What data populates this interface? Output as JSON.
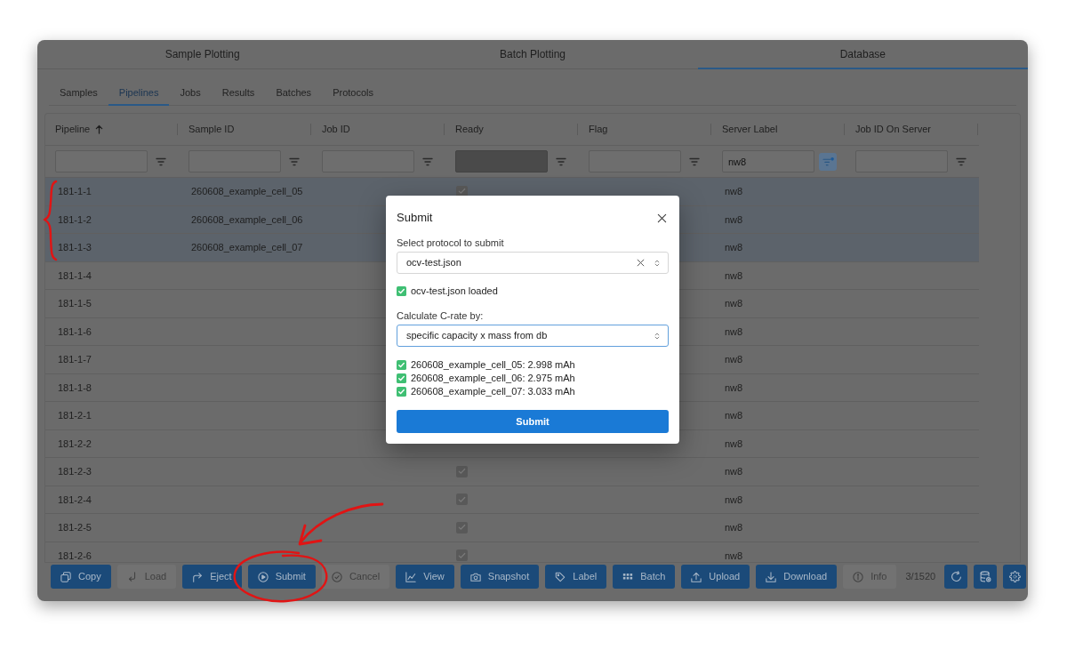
{
  "main_tabs": [
    {
      "label": "Sample Plotting",
      "selected": false
    },
    {
      "label": "Batch Plotting",
      "selected": false
    },
    {
      "label": "Database",
      "selected": true
    }
  ],
  "sub_tabs": [
    {
      "label": "Samples",
      "selected": false
    },
    {
      "label": "Pipelines",
      "selected": true
    },
    {
      "label": "Jobs",
      "selected": false
    },
    {
      "label": "Results",
      "selected": false
    },
    {
      "label": "Batches",
      "selected": false
    },
    {
      "label": "Protocols",
      "selected": false
    }
  ],
  "table": {
    "columns": [
      {
        "label": "Pipeline",
        "sorted": true,
        "filter": {
          "disabled": false,
          "active": false
        }
      },
      {
        "label": "Sample ID",
        "sorted": false,
        "filter": {
          "disabled": false,
          "active": false
        }
      },
      {
        "label": "Job ID",
        "sorted": false,
        "filter": {
          "disabled": false,
          "active": false
        }
      },
      {
        "label": "Ready",
        "sorted": false,
        "filter": {
          "disabled": true,
          "active": false
        }
      },
      {
        "label": "Flag",
        "sorted": false,
        "filter": {
          "disabled": false,
          "active": false
        }
      },
      {
        "label": "Server Label",
        "sorted": false,
        "filter": {
          "value": "nw8",
          "disabled": false,
          "active": true
        }
      },
      {
        "label": "Job ID On Server",
        "sorted": false,
        "filter": {
          "disabled": false,
          "active": false
        }
      }
    ],
    "rows": [
      {
        "pipeline": "181-1-1",
        "sample_id": "260608_example_cell_05",
        "ready": true,
        "server_label": "nw8",
        "selected": true
      },
      {
        "pipeline": "181-1-2",
        "sample_id": "260608_example_cell_06",
        "server_label": "nw8",
        "selected": true
      },
      {
        "pipeline": "181-1-3",
        "sample_id": "260608_example_cell_07",
        "server_label": "nw8",
        "selected": true
      },
      {
        "pipeline": "181-1-4",
        "server_label": "nw8",
        "selected": false
      },
      {
        "pipeline": "181-1-5",
        "server_label": "nw8",
        "selected": false
      },
      {
        "pipeline": "181-1-6",
        "server_label": "nw8",
        "selected": false
      },
      {
        "pipeline": "181-1-7",
        "server_label": "nw8",
        "selected": false
      },
      {
        "pipeline": "181-1-8",
        "server_label": "nw8",
        "selected": false
      },
      {
        "pipeline": "181-2-1",
        "server_label": "nw8",
        "selected": false
      },
      {
        "pipeline": "181-2-2",
        "server_label": "nw8",
        "selected": false
      },
      {
        "pipeline": "181-2-3",
        "ready": true,
        "server_label": "nw8",
        "selected": false
      },
      {
        "pipeline": "181-2-4",
        "ready": true,
        "server_label": "nw8",
        "selected": false
      },
      {
        "pipeline": "181-2-5",
        "ready": true,
        "server_label": "nw8",
        "selected": false
      },
      {
        "pipeline": "181-2-6",
        "ready": true,
        "server_label": "nw8",
        "selected": false
      }
    ]
  },
  "toolbar": {
    "buttons": [
      {
        "label": "Copy",
        "disabled": false
      },
      {
        "label": "Load",
        "disabled": true
      },
      {
        "label": "Eject",
        "disabled": false
      },
      {
        "label": "Submit",
        "disabled": false
      },
      {
        "label": "Cancel",
        "disabled": true
      },
      {
        "label": "View",
        "disabled": false
      },
      {
        "label": "Snapshot",
        "disabled": false
      },
      {
        "label": "Label",
        "disabled": false
      },
      {
        "label": "Batch",
        "disabled": false
      },
      {
        "label": "Upload",
        "disabled": false
      },
      {
        "label": "Download",
        "disabled": false
      },
      {
        "label": "Info",
        "disabled": true
      }
    ],
    "count": "3/1520"
  },
  "dialog": {
    "title": "Submit",
    "protocol_select": {
      "label": "Select protocol to submit",
      "value": "ocv-test.json",
      "clearable": true,
      "focused": false
    },
    "protocol_status": {
      "text": "ocv-test.json loaded",
      "ok": true
    },
    "c_rate_select": {
      "label": "Calculate C-rate by:",
      "value": "specific capacity x mass from db",
      "clearable": false,
      "focused": true
    },
    "capacities": [
      {
        "text": "260608_example_cell_05: 2.998 mAh",
        "ok": true
      },
      {
        "text": "260608_example_cell_06: 2.975 mAh",
        "ok": true
      },
      {
        "text": "260608_example_cell_07: 3.033 mAh",
        "ok": true
      }
    ],
    "submit_label": "Submit"
  },
  "annotations": [
    {
      "kind": "brace"
    },
    {
      "kind": "arrow"
    },
    {
      "kind": "circle"
    }
  ]
}
